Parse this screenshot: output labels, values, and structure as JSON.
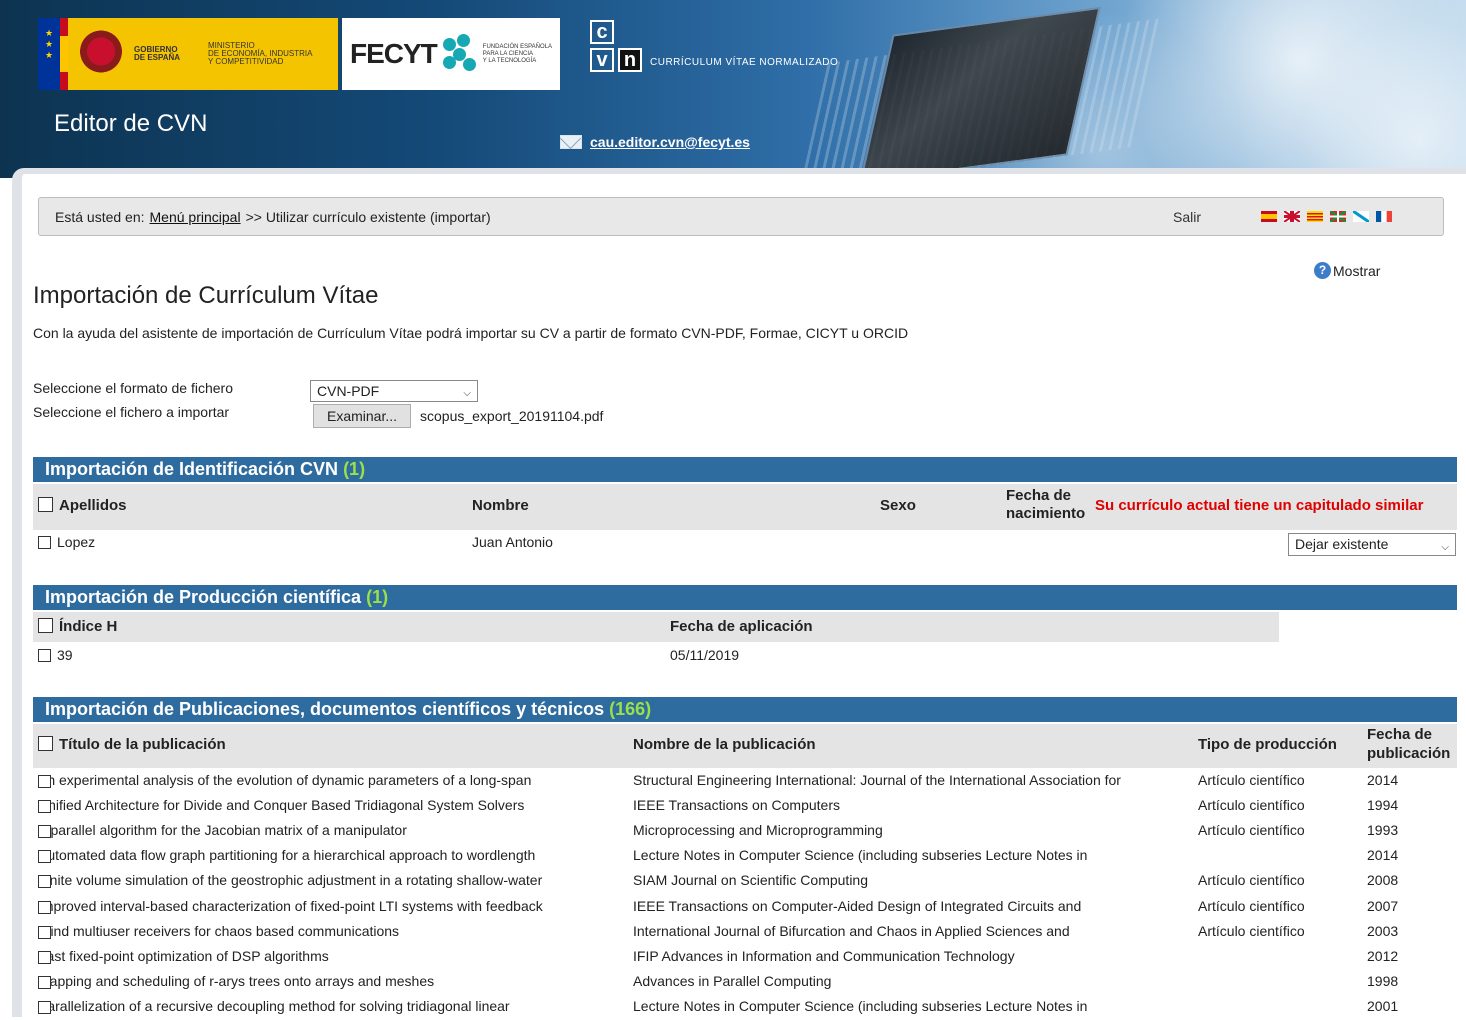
{
  "header": {
    "eu_flag_stars": "★ ★ ★",
    "gov_label_1": "GOBIERNO",
    "gov_label_2": "DE ESPAÑA",
    "ministry_1": "MINISTERIO",
    "ministry_2": "DE ECONOMÍA, INDUSTRIA",
    "ministry_3": "Y COMPETITIVIDAD",
    "fecyt_word": "FECYT",
    "fecyt_sub_1": "FUNDACIÓN ESPAÑOLA",
    "fecyt_sub_2": "PARA LA CIENCIA",
    "fecyt_sub_3": "Y LA TECNOLOGÍA",
    "cvn_letters": [
      "c",
      "v",
      "n"
    ],
    "cvn_sub": "CURRÍCULUM VÍTAE NORMALIZADO",
    "title": "Editor de CVN",
    "email": "cau.editor.cvn@fecyt.es"
  },
  "breadcrumb": {
    "prefix": "Está usted en:",
    "link": "Menú principal",
    "suffix": ">> Utilizar currículo existente (importar)",
    "salir": "Salir",
    "flags": [
      "es",
      "en",
      "ca",
      "eu",
      "gl",
      "fr"
    ]
  },
  "help": {
    "icon": "?",
    "label": "Mostrar"
  },
  "page": {
    "title": "Importación de Currículum Vítae",
    "description": "Con la ayuda del asistente de importación de Currículum Vítae podrá importar su CV a partir de formato CVN-PDF, Formae, CICYT u ORCID"
  },
  "form": {
    "format_label": "Seleccione el formato de fichero",
    "format_value": "CVN-PDF",
    "file_label": "Seleccione el fichero a importar",
    "browse_label": "Examinar...",
    "file_name": "scopus_export_20191104.pdf"
  },
  "identificacion": {
    "title": "Importación de Identificación CVN",
    "count": "(1)",
    "columns": [
      "Apellidos",
      "Nombre",
      "Sexo",
      "Fecha de",
      "nacimiento"
    ],
    "warning": "Su currículo actual tiene un capitulado similar",
    "row": {
      "apellidos": "Lopez",
      "nombre": "Juan Antonio",
      "action": "Dejar existente"
    }
  },
  "produccion": {
    "title": "Importación de Producción científica",
    "count": "(1)",
    "columns": [
      "Índice H",
      "Fecha de aplicación"
    ],
    "row": {
      "indice": "39",
      "fecha": "05/11/2019"
    }
  },
  "publicaciones": {
    "title": "Importación de Publicaciones, documentos científicos y técnicos",
    "count": "(166)",
    "columns": [
      "Título de la publicación",
      "Nombre de la publicación",
      "Tipo de producción",
      "Fecha de",
      "publicación"
    ],
    "rows": [
      {
        "titulo": "An experimental analysis of the evolution of dynamic parameters of a long-span",
        "nombre": "Structural Engineering International: Journal of the International Association for",
        "tipo": "Artículo científico",
        "fecha": "2014"
      },
      {
        "titulo": "Unified Architecture for Divide and Conquer Based Tridiagonal System Solvers",
        "nombre": "IEEE Transactions on Computers",
        "tipo": "Artículo científico",
        "fecha": "1994"
      },
      {
        "titulo": "A parallel algorithm for the Jacobian matrix of a manipulator",
        "nombre": "Microprocessing and Microprogramming",
        "tipo": "Artículo científico",
        "fecha": "1993"
      },
      {
        "titulo": "Automated data flow graph partitioning for a hierarchical approach to wordlength",
        "nombre": "Lecture Notes in Computer Science (including subseries Lecture Notes in",
        "tipo": "",
        "fecha": "2014"
      },
      {
        "titulo": "Finite volume simulation of the geostrophic adjustment in a rotating shallow-water",
        "nombre": "SIAM Journal on Scientific Computing",
        "tipo": "Artículo científico",
        "fecha": "2008"
      },
      {
        "titulo": "Improved interval-based characterization of fixed-point LTI systems with feedback",
        "nombre": "IEEE Transactions on Computer-Aided Design of Integrated Circuits and",
        "tipo": "Artículo científico",
        "fecha": "2007"
      },
      {
        "titulo": "Blind multiuser receivers for chaos based communications",
        "nombre": "International Journal of Bifurcation and Chaos in Applied Sciences and",
        "tipo": "Artículo científico",
        "fecha": "2003"
      },
      {
        "titulo": "Fast fixed-point optimization of DSP algorithms",
        "nombre": "IFIP Advances in Information and Communication Technology",
        "tipo": "",
        "fecha": "2012"
      },
      {
        "titulo": "Mapping and scheduling of r-arys trees onto arrays and meshes",
        "nombre": "Advances in Parallel Computing",
        "tipo": "",
        "fecha": "1998"
      },
      {
        "titulo": "Parallelization of a recursive decoupling method for solving tridiagonal linear",
        "nombre": "Lecture Notes in Computer Science (including subseries Lecture Notes in",
        "tipo": "",
        "fecha": "2001"
      }
    ]
  },
  "colors": {
    "section_bar": "#2e6b9e",
    "count_green": "#9ae04a",
    "warning_red": "#e00000"
  }
}
